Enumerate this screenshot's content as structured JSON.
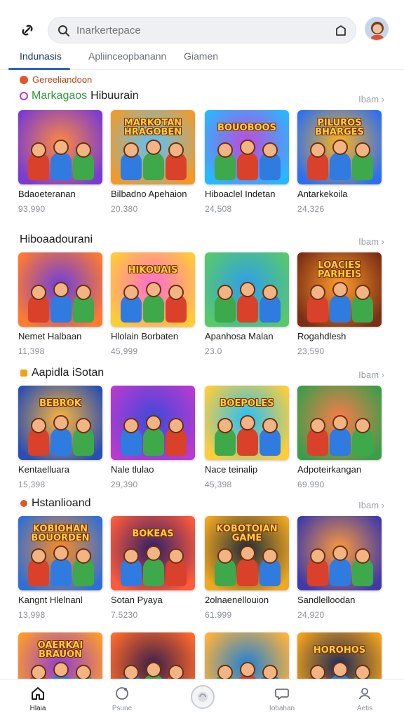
{
  "header": {
    "logo_icon": "link-icon",
    "search": {
      "placeholder": "Inarkertepace",
      "value": ""
    },
    "bag_icon": "shopping-bag-icon"
  },
  "tabs": [
    {
      "label": "Indunasis"
    },
    {
      "label": "Apliinceopbanann"
    },
    {
      "label": "Giamen"
    }
  ],
  "breadcrumb": "Gereeliandoon",
  "sections": [
    {
      "title_green": "Markagaos",
      "title": "Hibuurain",
      "see_all": "Ibam",
      "items": [
        {
          "title": "Bdaoeteranan",
          "meta": "93,990",
          "banner": "",
          "bg1": "#ff8a3d",
          "bg2": "#7a3bd1"
        },
        {
          "title": "Bilbadno Apehaion",
          "meta": "20.380",
          "banner": "MARKOTAN HRAGOBEN",
          "bg1": "#57c3ff",
          "bg2": "#f19a2a"
        },
        {
          "title": "Hiboaclel Indetan",
          "meta": "24,508",
          "banner": "BOUOBOOS",
          "bg1": "#c447d9",
          "bg2": "#28b8ff"
        },
        {
          "title": "Antarkekoila",
          "meta": "24,326",
          "banner": "PILUROS BHARGES",
          "bg1": "#ffb31a",
          "bg2": "#2d6ff0"
        }
      ]
    },
    {
      "title_green": "",
      "title": "Hiboaadourani",
      "see_all": "Ibam",
      "items": [
        {
          "title": "Nemet Halbaan",
          "meta": "11,398",
          "banner": "",
          "bg1": "#6a3ee0",
          "bg2": "#ff7b2f"
        },
        {
          "title": "Hlolain Borbaten",
          "meta": "45,999",
          "banner": "HIKOUAIS",
          "bg1": "#ff6ad5",
          "bg2": "#ffcc33"
        },
        {
          "title": "Apanhosa Malan",
          "meta": "23.0",
          "banner": "",
          "bg1": "#2e9df0",
          "bg2": "#58c96b"
        },
        {
          "title": "Rogahdlesh",
          "meta": "23,590",
          "banner": "LOACIES PARHEIS",
          "bg1": "#ff9c2b",
          "bg2": "#7b2e14"
        }
      ]
    },
    {
      "title_green": "",
      "title": "Aapidla iSotan",
      "see_all": "Ibam",
      "items": [
        {
          "title": "Kentaelluara",
          "meta": "15,398",
          "banner": "BEBROK",
          "bg1": "#ffb637",
          "bg2": "#2a4fb2"
        },
        {
          "title": "Nale tlulao",
          "meta": "29,390",
          "banner": "",
          "bg1": "#3b4ad9",
          "bg2": "#b73ad1"
        },
        {
          "title": "Nace teinalip",
          "meta": "45,398",
          "banner": "BOEPOLES",
          "bg1": "#20c0ff",
          "bg2": "#ffcd3a"
        },
        {
          "title": "Adpoteirkangan",
          "meta": "69.990",
          "banner": "",
          "bg1": "#ff7a4a",
          "bg2": "#3d9d4a"
        }
      ]
    },
    {
      "title_green": "",
      "title": "Hstanlioand",
      "see_all": "Ibam",
      "items": [
        {
          "title": "Kangnt Hlelnanl",
          "meta": "13,998",
          "banner": "KOBIOHAN BOUORDEN",
          "bg1": "#ff8b1f",
          "bg2": "#2f6fd6"
        },
        {
          "title": "Sotan Pyaya",
          "meta": "7.5230",
          "banner": "BOKEAS",
          "bg1": "#2b1e6b",
          "bg2": "#ff5a3a"
        },
        {
          "title": "2olnaenellouion",
          "meta": "61.999",
          "banner": "KOBOTOIAN GAME",
          "bg1": "#1e2a3a",
          "bg2": "#f0a820"
        },
        {
          "title": "Sandlelloodan",
          "meta": "24,920",
          "banner": "",
          "bg1": "#ff9b3a",
          "bg2": "#3f3aa8"
        }
      ]
    },
    {
      "title_green": "",
      "title": "",
      "see_all": "",
      "items": [
        {
          "title": "",
          "meta": "",
          "banner": "OAERKAI BRAUON",
          "bg1": "#8e3bd6",
          "bg2": "#ff9c2b"
        },
        {
          "title": "",
          "meta": "",
          "banner": "",
          "bg1": "#3a1e4a",
          "bg2": "#ff6a2a"
        },
        {
          "title": "",
          "meta": "",
          "banner": "",
          "bg1": "#1c7fd9",
          "bg2": "#ffb33a"
        },
        {
          "title": "",
          "meta": "",
          "banner": "HOROHOS",
          "bg1": "#1a2656",
          "bg2": "#f2a21a"
        }
      ]
    }
  ],
  "bottom_nav": [
    {
      "label": "Hlaia",
      "icon": "home-icon"
    },
    {
      "label": "Psune",
      "icon": "compass-icon"
    },
    {
      "label": "",
      "icon": "center-action-icon"
    },
    {
      "label": "Iobahan",
      "icon": "chat-bubble-icon"
    },
    {
      "label": "Aetis",
      "icon": "profile-icon"
    }
  ],
  "colors": {
    "accent": "#2a64c4",
    "green_label": "#2f9a3a",
    "breadcrumb": "#b34b1a"
  }
}
